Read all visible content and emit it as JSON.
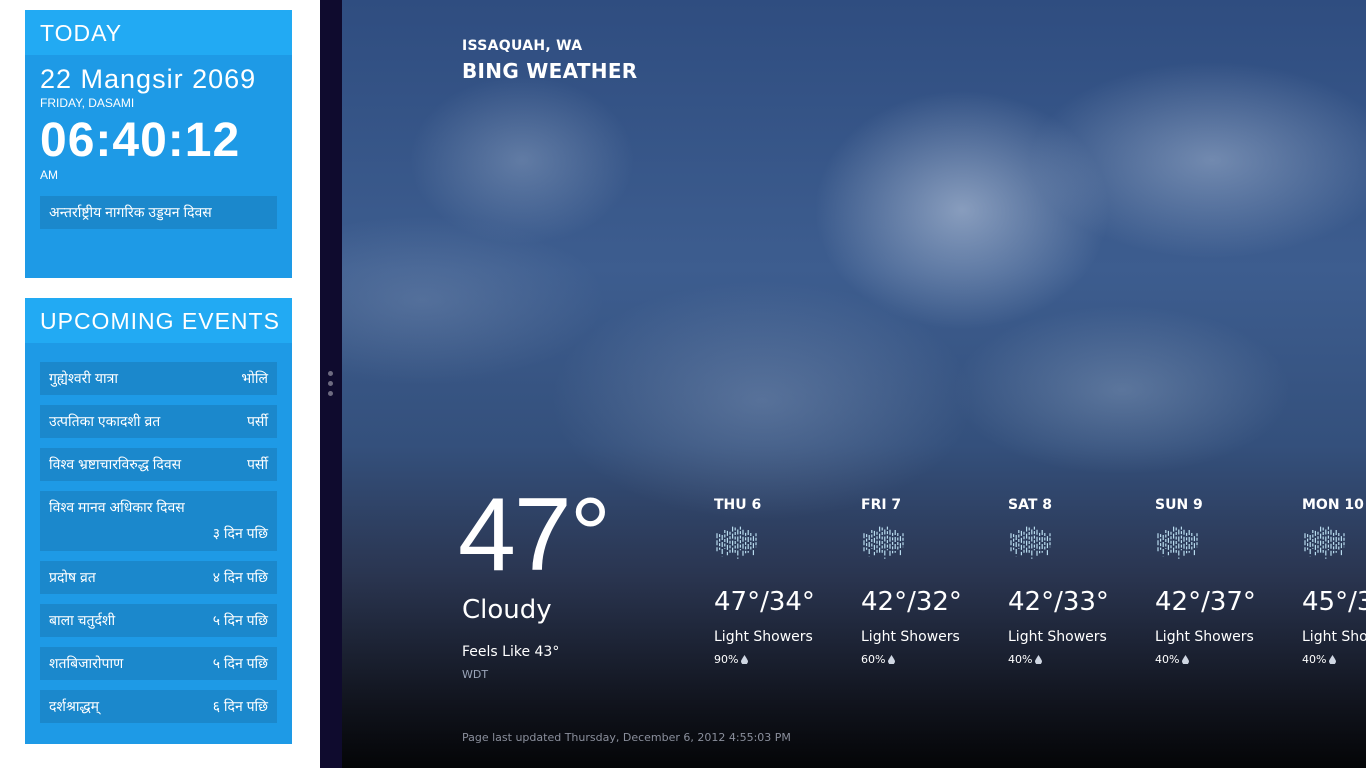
{
  "calendar": {
    "today": {
      "heading": "TODAY",
      "date": "22 Mangsir 2069",
      "weekday": "FRIDAY, DASAMI",
      "time": "06:40:12",
      "ampm": "AM",
      "holiday": "अन्तर्राष्ट्रीय नागरिक उड्डयन दिवस"
    },
    "upcoming": {
      "heading": "UPCOMING EVENTS",
      "events": [
        {
          "name": "गुह्येश्वरी यात्रा",
          "when": "भोलि"
        },
        {
          "name": "उत्पतिका एकादशी व्रत",
          "when": "पर्सी"
        },
        {
          "name": "विश्व भ्रष्टाचारविरुद्ध दिवस",
          "when": "पर्सी"
        },
        {
          "name": "विश्व मानव अधिकार दिवस",
          "when": "३ दिन पछि"
        },
        {
          "name": "प्रदोष व्रत",
          "when": "४ दिन पछि"
        },
        {
          "name": "बाला चतुर्दशी",
          "when": "५ दिन पछि"
        },
        {
          "name": "शतबिजारोपाण",
          "when": "५ दिन पछि"
        },
        {
          "name": "दर्शश्राद्धम्",
          "when": "६ दिन पछि"
        }
      ]
    }
  },
  "weather": {
    "location": "ISSAQUAH, WA",
    "app_title": "BING WEATHER",
    "current": {
      "temp": "47°",
      "condition": "Cloudy",
      "feels_like": "Feels Like 43°",
      "station": "WDT"
    },
    "forecast": [
      {
        "day": "THU 6",
        "hilo": "47°/34°",
        "condition": "Light Showers",
        "precip": "90%",
        "icon": "rain-icon"
      },
      {
        "day": "FRI 7",
        "hilo": "42°/32°",
        "condition": "Light Showers",
        "precip": "60%",
        "icon": "rain-icon"
      },
      {
        "day": "SAT 8",
        "hilo": "42°/33°",
        "condition": "Light Showers",
        "precip": "40%",
        "icon": "rain-icon"
      },
      {
        "day": "SUN 9",
        "hilo": "42°/37°",
        "condition": "Light Showers",
        "precip": "40%",
        "icon": "rain-icon"
      },
      {
        "day": "MON 10",
        "hilo": "45°/3",
        "condition": "Light Sho",
        "precip": "40%",
        "icon": "rain-icon"
      }
    ],
    "last_updated": "Page last updated Thursday, December 6, 2012 4:55:03 PM"
  },
  "colors": {
    "calendar_card": "#1e9ae6",
    "calendar_header": "#22aaf3",
    "calendar_row": "#1b88cc",
    "splitter": "#0f0b2e",
    "rain_icon": "#b9dcef"
  }
}
